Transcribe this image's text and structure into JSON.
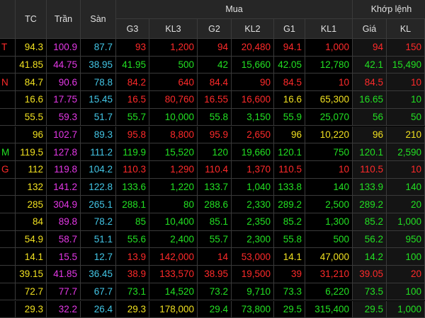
{
  "header": {
    "tc": "TC",
    "tran": "Trần",
    "san": "Sàn",
    "mua": "Mua",
    "khop_lenh": "Khớp lệnh",
    "g3": "G3",
    "kl3": "KL3",
    "g2": "G2",
    "kl2": "KL2",
    "g1": "G1",
    "kl1": "KL1",
    "gia": "Giá",
    "kl": "KL"
  },
  "colors": {
    "up": "#22e022",
    "down": "#ff2a2a",
    "reference": "#f0e020",
    "ceiling": "#e438e6",
    "floor": "#43c6e6"
  },
  "rows": [
    {
      "sym": "T",
      "symc": "down",
      "tc": "94.3",
      "tran": "100.9",
      "san": "87.7",
      "g3": "93",
      "g3c": "down",
      "kl3": "1,200",
      "g2": "94",
      "g2c": "down",
      "kl2": "20,480",
      "g1": "94.1",
      "g1c": "down",
      "kl1": "1,000",
      "gia": "94",
      "giac": "down",
      "kl": "150"
    },
    {
      "sym": "",
      "symc": "up",
      "tc": "41.85",
      "tran": "44.75",
      "san": "38.95",
      "g3": "41.95",
      "g3c": "up",
      "kl3": "500",
      "g2": "42",
      "g2c": "up",
      "kl2": "15,660",
      "g1": "42.05",
      "g1c": "up",
      "kl1": "12,780",
      "gia": "42.1",
      "giac": "up",
      "kl": "15,490"
    },
    {
      "sym": "N",
      "symc": "down",
      "tc": "84.7",
      "tran": "90.6",
      "san": "78.8",
      "g3": "84.2",
      "g3c": "down",
      "kl3": "640",
      "g2": "84.4",
      "g2c": "down",
      "kl2": "90",
      "g1": "84.5",
      "g1c": "down",
      "kl1": "10",
      "gia": "84.5",
      "giac": "down",
      "kl": "10"
    },
    {
      "sym": "",
      "symc": "up",
      "tc": "16.6",
      "tran": "17.75",
      "san": "15.45",
      "g3": "16.5",
      "g3c": "down",
      "kl3": "80,760",
      "g2": "16.55",
      "g2c": "down",
      "kl2": "16,600",
      "g1": "16.6",
      "g1c": "ref",
      "kl1": "65,300",
      "gia": "16.65",
      "giac": "up",
      "kl": "10"
    },
    {
      "sym": "",
      "symc": "up",
      "tc": "55.5",
      "tran": "59.3",
      "san": "51.7",
      "g3": "55.7",
      "g3c": "up",
      "kl3": "10,000",
      "g2": "55.8",
      "g2c": "up",
      "kl2": "3,150",
      "g1": "55.9",
      "g1c": "up",
      "kl1": "25,070",
      "gia": "56",
      "giac": "up",
      "kl": "50"
    },
    {
      "sym": "",
      "symc": "ref",
      "tc": "96",
      "tran": "102.7",
      "san": "89.3",
      "g3": "95.8",
      "g3c": "down",
      "kl3": "8,800",
      "g2": "95.9",
      "g2c": "down",
      "kl2": "2,650",
      "g1": "96",
      "g1c": "ref",
      "kl1": "10,220",
      "gia": "96",
      "giac": "ref",
      "kl": "210"
    },
    {
      "sym": "M",
      "symc": "up",
      "tc": "119.5",
      "tran": "127.8",
      "san": "111.2",
      "g3": "119.9",
      "g3c": "up",
      "kl3": "15,520",
      "g2": "120",
      "g2c": "up",
      "kl2": "19,660",
      "g1": "120.1",
      "g1c": "up",
      "kl1": "750",
      "gia": "120.1",
      "giac": "up",
      "kl": "2,590"
    },
    {
      "sym": "G",
      "symc": "down",
      "tc": "112",
      "tran": "119.8",
      "san": "104.2",
      "g3": "110.3",
      "g3c": "down",
      "kl3": "1,290",
      "g2": "110.4",
      "g2c": "down",
      "kl2": "1,370",
      "g1": "110.5",
      "g1c": "down",
      "kl1": "10",
      "gia": "110.5",
      "giac": "down",
      "kl": "10"
    },
    {
      "sym": "",
      "symc": "up",
      "tc": "132",
      "tran": "141.2",
      "san": "122.8",
      "g3": "133.6",
      "g3c": "up",
      "kl3": "1,220",
      "g2": "133.7",
      "g2c": "up",
      "kl2": "1,040",
      "g1": "133.8",
      "g1c": "up",
      "kl1": "140",
      "gia": "133.9",
      "giac": "up",
      "kl": "140"
    },
    {
      "sym": "",
      "symc": "up",
      "tc": "285",
      "tran": "304.9",
      "san": "265.1",
      "g3": "288.1",
      "g3c": "up",
      "kl3": "80",
      "g2": "288.6",
      "g2c": "up",
      "kl2": "2,330",
      "g1": "289.2",
      "g1c": "up",
      "kl1": "2,500",
      "gia": "289.2",
      "giac": "up",
      "kl": "20"
    },
    {
      "sym": "",
      "symc": "up",
      "tc": "84",
      "tran": "89.8",
      "san": "78.2",
      "g3": "85",
      "g3c": "up",
      "kl3": "10,400",
      "g2": "85.1",
      "g2c": "up",
      "kl2": "2,350",
      "g1": "85.2",
      "g1c": "up",
      "kl1": "1,300",
      "gia": "85.2",
      "giac": "up",
      "kl": "1,000"
    },
    {
      "sym": "",
      "symc": "up",
      "tc": "54.9",
      "tran": "58.7",
      "san": "51.1",
      "g3": "55.6",
      "g3c": "up",
      "kl3": "2,400",
      "g2": "55.7",
      "g2c": "up",
      "kl2": "2,300",
      "g1": "55.8",
      "g1c": "up",
      "kl1": "500",
      "gia": "56.2",
      "giac": "up",
      "kl": "950"
    },
    {
      "sym": "",
      "symc": "up",
      "tc": "14.1",
      "tran": "15.5",
      "san": "12.7",
      "g3": "13.9",
      "g3c": "down",
      "kl3": "142,000",
      "g2": "14",
      "g2c": "down",
      "kl2": "53,000",
      "g1": "14.1",
      "g1c": "ref",
      "kl1": "47,000",
      "gia": "14.2",
      "giac": "up",
      "kl": "100"
    },
    {
      "sym": "",
      "symc": "down",
      "tc": "39.15",
      "tran": "41.85",
      "san": "36.45",
      "g3": "38.9",
      "g3c": "down",
      "kl3": "133,570",
      "g2": "38.95",
      "g2c": "down",
      "kl2": "19,500",
      "g1": "39",
      "g1c": "down",
      "kl1": "31,210",
      "gia": "39.05",
      "giac": "down",
      "kl": "20"
    },
    {
      "sym": "",
      "symc": "up",
      "tc": "72.7",
      "tran": "77.7",
      "san": "67.7",
      "g3": "73.1",
      "g3c": "up",
      "kl3": "14,520",
      "g2": "73.2",
      "g2c": "up",
      "kl2": "9,710",
      "g1": "73.3",
      "g1c": "up",
      "kl1": "6,220",
      "gia": "73.5",
      "giac": "up",
      "kl": "100"
    },
    {
      "sym": "",
      "symc": "up",
      "tc": "29.3",
      "tran": "32.2",
      "san": "26.4",
      "g3": "29.3",
      "g3c": "ref",
      "kl3": "178,000",
      "g2": "29.4",
      "g2c": "up",
      "kl2": "73,800",
      "g1": "29.5",
      "g1c": "up",
      "kl1": "315,400",
      "gia": "29.5",
      "giac": "up",
      "kl": "1,000"
    }
  ]
}
